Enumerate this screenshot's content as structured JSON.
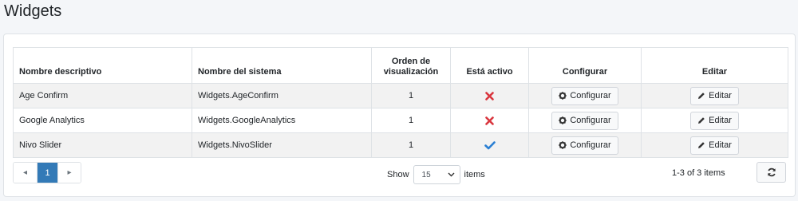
{
  "page": {
    "title": "Widgets"
  },
  "table": {
    "headers": {
      "name": "Nombre descriptivo",
      "system": "Nombre del sistema",
      "order_line1": "Orden de",
      "order_line2": "visualización",
      "active": "Está activo",
      "configure": "Configurar",
      "edit": "Editar"
    },
    "rows": [
      {
        "name": "Age Confirm",
        "system": "Widgets.AgeConfirm",
        "order": "1",
        "active": false,
        "configure_label": "Configurar",
        "edit_label": "Editar"
      },
      {
        "name": "Google Analytics",
        "system": "Widgets.GoogleAnalytics",
        "order": "1",
        "active": false,
        "configure_label": "Configurar",
        "edit_label": "Editar"
      },
      {
        "name": "Nivo Slider",
        "system": "Widgets.NivoSlider",
        "order": "1",
        "active": true,
        "configure_label": "Configurar",
        "edit_label": "Editar"
      }
    ]
  },
  "footer": {
    "pager": {
      "prev_icon": "◂",
      "current_page": "1",
      "next_icon": "▸"
    },
    "show_label": "Show",
    "page_size": "15",
    "items_label": "items",
    "range_text": "1-3 of 3 items",
    "refresh_icon": "refresh-icon"
  },
  "colors": {
    "inactive": "#d9363e",
    "active": "#2a7fd3",
    "pager_active": "#337ab7"
  }
}
